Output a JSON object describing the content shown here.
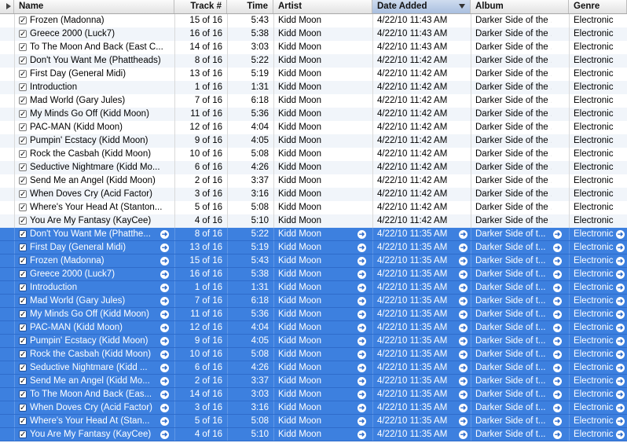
{
  "columns": {
    "name": "Name",
    "track": "Track #",
    "time": "Time",
    "artist": "Artist",
    "date_added": "Date Added",
    "album": "Album",
    "genre": "Genre"
  },
  "rows": [
    {
      "name": "Frozen (Madonna)",
      "track": "15 of 16",
      "time": "5:43",
      "artist": "Kidd Moon",
      "date": "4/22/10 11:43 AM",
      "album": "Darker Side of the ...",
      "genre": "Electronic",
      "selected": false
    },
    {
      "name": "Greece 2000 (Luck7)",
      "track": "16 of 16",
      "time": "5:38",
      "artist": "Kidd Moon",
      "date": "4/22/10 11:43 AM",
      "album": "Darker Side of the ...",
      "genre": "Electronic",
      "selected": false
    },
    {
      "name": "To The Moon And Back (East C...",
      "track": "14 of 16",
      "time": "3:03",
      "artist": "Kidd Moon",
      "date": "4/22/10 11:43 AM",
      "album": "Darker Side of the ...",
      "genre": "Electronic",
      "selected": false
    },
    {
      "name": "Don't You Want Me (Phattheads)",
      "track": "8 of 16",
      "time": "5:22",
      "artist": "Kidd Moon",
      "date": "4/22/10 11:42 AM",
      "album": "Darker Side of the ...",
      "genre": "Electronic",
      "selected": false
    },
    {
      "name": "First Day (General Midi)",
      "track": "13 of 16",
      "time": "5:19",
      "artist": "Kidd Moon",
      "date": "4/22/10 11:42 AM",
      "album": "Darker Side of the ...",
      "genre": "Electronic",
      "selected": false
    },
    {
      "name": "Introduction",
      "track": "1 of 16",
      "time": "1:31",
      "artist": "Kidd Moon",
      "date": "4/22/10 11:42 AM",
      "album": "Darker Side of the ...",
      "genre": "Electronic",
      "selected": false
    },
    {
      "name": "Mad World (Gary Jules)",
      "track": "7 of 16",
      "time": "6:18",
      "artist": "Kidd Moon",
      "date": "4/22/10 11:42 AM",
      "album": "Darker Side of the ...",
      "genre": "Electronic",
      "selected": false
    },
    {
      "name": "My Minds Go Off (Kidd Moon)",
      "track": "11 of 16",
      "time": "5:36",
      "artist": "Kidd Moon",
      "date": "4/22/10 11:42 AM",
      "album": "Darker Side of the ...",
      "genre": "Electronic",
      "selected": false
    },
    {
      "name": "PAC-MAN (Kidd Moon)",
      "track": "12 of 16",
      "time": "4:04",
      "artist": "Kidd Moon",
      "date": "4/22/10 11:42 AM",
      "album": "Darker Side of the ...",
      "genre": "Electronic",
      "selected": false
    },
    {
      "name": "Pumpin' Ecstacy (Kidd Moon)",
      "track": "9 of 16",
      "time": "4:05",
      "artist": "Kidd Moon",
      "date": "4/22/10 11:42 AM",
      "album": "Darker Side of the ...",
      "genre": "Electronic",
      "selected": false
    },
    {
      "name": "Rock the Casbah (Kidd Moon)",
      "track": "10 of 16",
      "time": "5:08",
      "artist": "Kidd Moon",
      "date": "4/22/10 11:42 AM",
      "album": "Darker Side of the ...",
      "genre": "Electronic",
      "selected": false
    },
    {
      "name": "Seductive Nightmare (Kidd Mo...",
      "track": "6 of 16",
      "time": "4:26",
      "artist": "Kidd Moon",
      "date": "4/22/10 11:42 AM",
      "album": "Darker Side of the ...",
      "genre": "Electronic",
      "selected": false
    },
    {
      "name": "Send Me an Angel (Kidd Moon)",
      "track": "2 of 16",
      "time": "3:37",
      "artist": "Kidd Moon",
      "date": "4/22/10 11:42 AM",
      "album": "Darker Side of the ...",
      "genre": "Electronic",
      "selected": false
    },
    {
      "name": "When Doves Cry (Acid Factor)",
      "track": "3 of 16",
      "time": "3:16",
      "artist": "Kidd Moon",
      "date": "4/22/10 11:42 AM",
      "album": "Darker Side of the ...",
      "genre": "Electronic",
      "selected": false
    },
    {
      "name": "Where's Your Head At (Stanton...",
      "track": "5 of 16",
      "time": "5:08",
      "artist": "Kidd Moon",
      "date": "4/22/10 11:42 AM",
      "album": "Darker Side of the ...",
      "genre": "Electronic",
      "selected": false
    },
    {
      "name": "You Are My Fantasy (KayCee)",
      "track": "4 of 16",
      "time": "5:10",
      "artist": "Kidd Moon",
      "date": "4/22/10 11:42 AM",
      "album": "Darker Side of the ...",
      "genre": "Electronic",
      "selected": false
    },
    {
      "name": "Don't You Want Me (Phatthe...",
      "track": "8 of 16",
      "time": "5:22",
      "artist": "Kidd Moon",
      "date": "4/22/10 11:35 AM",
      "album": "Darker Side of t...",
      "genre": "Electronic",
      "selected": true
    },
    {
      "name": "First Day (General Midi)",
      "track": "13 of 16",
      "time": "5:19",
      "artist": "Kidd Moon",
      "date": "4/22/10 11:35 AM",
      "album": "Darker Side of t...",
      "genre": "Electronic",
      "selected": true
    },
    {
      "name": "Frozen (Madonna)",
      "track": "15 of 16",
      "time": "5:43",
      "artist": "Kidd Moon",
      "date": "4/22/10 11:35 AM",
      "album": "Darker Side of t...",
      "genre": "Electronic",
      "selected": true
    },
    {
      "name": "Greece 2000 (Luck7)",
      "track": "16 of 16",
      "time": "5:38",
      "artist": "Kidd Moon",
      "date": "4/22/10 11:35 AM",
      "album": "Darker Side of t...",
      "genre": "Electronic",
      "selected": true
    },
    {
      "name": "Introduction",
      "track": "1 of 16",
      "time": "1:31",
      "artist": "Kidd Moon",
      "date": "4/22/10 11:35 AM",
      "album": "Darker Side of t...",
      "genre": "Electronic",
      "selected": true
    },
    {
      "name": "Mad World (Gary Jules)",
      "track": "7 of 16",
      "time": "6:18",
      "artist": "Kidd Moon",
      "date": "4/22/10 11:35 AM",
      "album": "Darker Side of t...",
      "genre": "Electronic",
      "selected": true
    },
    {
      "name": "My Minds Go Off (Kidd Moon)",
      "track": "11 of 16",
      "time": "5:36",
      "artist": "Kidd Moon",
      "date": "4/22/10 11:35 AM",
      "album": "Darker Side of t...",
      "genre": "Electronic",
      "selected": true
    },
    {
      "name": "PAC-MAN (Kidd Moon)",
      "track": "12 of 16",
      "time": "4:04",
      "artist": "Kidd Moon",
      "date": "4/22/10 11:35 AM",
      "album": "Darker Side of t...",
      "genre": "Electronic",
      "selected": true
    },
    {
      "name": "Pumpin' Ecstacy (Kidd Moon)",
      "track": "9 of 16",
      "time": "4:05",
      "artist": "Kidd Moon",
      "date": "4/22/10 11:35 AM",
      "album": "Darker Side of t...",
      "genre": "Electronic",
      "selected": true
    },
    {
      "name": "Rock the Casbah (Kidd Moon)",
      "track": "10 of 16",
      "time": "5:08",
      "artist": "Kidd Moon",
      "date": "4/22/10 11:35 AM",
      "album": "Darker Side of t...",
      "genre": "Electronic",
      "selected": true
    },
    {
      "name": "Seductive Nightmare (Kidd ...",
      "track": "6 of 16",
      "time": "4:26",
      "artist": "Kidd Moon",
      "date": "4/22/10 11:35 AM",
      "album": "Darker Side of t...",
      "genre": "Electronic",
      "selected": true
    },
    {
      "name": "Send Me an Angel (Kidd Mo...",
      "track": "2 of 16",
      "time": "3:37",
      "artist": "Kidd Moon",
      "date": "4/22/10 11:35 AM",
      "album": "Darker Side of t...",
      "genre": "Electronic",
      "selected": true
    },
    {
      "name": "To The Moon And Back (Eas...",
      "track": "14 of 16",
      "time": "3:03",
      "artist": "Kidd Moon",
      "date": "4/22/10 11:35 AM",
      "album": "Darker Side of t...",
      "genre": "Electronic",
      "selected": true
    },
    {
      "name": "When Doves Cry (Acid Factor)",
      "track": "3 of 16",
      "time": "3:16",
      "artist": "Kidd Moon",
      "date": "4/22/10 11:35 AM",
      "album": "Darker Side of t...",
      "genre": "Electronic",
      "selected": true
    },
    {
      "name": "Where's Your Head At (Stan...",
      "track": "5 of 16",
      "time": "5:08",
      "artist": "Kidd Moon",
      "date": "4/22/10 11:35 AM",
      "album": "Darker Side of t...",
      "genre": "Electronic",
      "selected": true
    },
    {
      "name": "You Are My Fantasy (KayCee)",
      "track": "4 of 16",
      "time": "5:10",
      "artist": "Kidd Moon",
      "date": "4/22/10 11:35 AM",
      "album": "Darker Side of t...",
      "genre": "Electronic",
      "selected": true
    }
  ],
  "icons": {
    "checkbox": "checkbox-checked-icon",
    "go_arrow": "go-arrow-icon",
    "sort": "sort-descending-icon",
    "collapse": "collapse-triangle-icon"
  },
  "glyphs": {
    "check": "✓",
    "arrow": "➜"
  },
  "colors": {
    "selection": "#3d80df",
    "stripe": "#f1f5fa",
    "sorted_header": "#a9bfdf"
  }
}
